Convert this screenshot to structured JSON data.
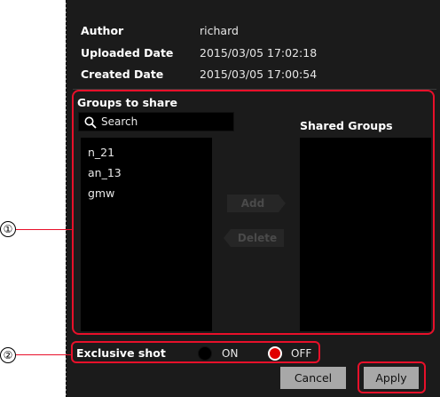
{
  "info": {
    "author_label": "Author",
    "author_value": "richard",
    "uploaded_label": "Uploaded Date",
    "uploaded_value": "2015/03/05 17:02:18",
    "created_label": "Created Date",
    "created_value": "2015/03/05 17:00:54"
  },
  "groups": {
    "title": "Groups to share",
    "search_placeholder": "Search",
    "available": [
      "n_21",
      "an_13",
      "gmw"
    ],
    "shared_title": "Shared Groups",
    "shared": [],
    "add_label": "Add",
    "delete_label": "Delete"
  },
  "exclusive": {
    "label": "Exclusive shot",
    "on_label": "ON",
    "off_label": "OFF",
    "selected": "OFF"
  },
  "buttons": {
    "cancel": "Cancel",
    "apply": "Apply"
  },
  "annotations": {
    "callout_1": "①",
    "callout_2": "②"
  },
  "colors": {
    "panel_bg": "#1b1b1b",
    "list_bg": "#000000",
    "highlight": "#e8102a",
    "radio_selected": "#e00000",
    "button_bg": "#a8a8a8"
  },
  "icons": {
    "search": "search-icon"
  }
}
